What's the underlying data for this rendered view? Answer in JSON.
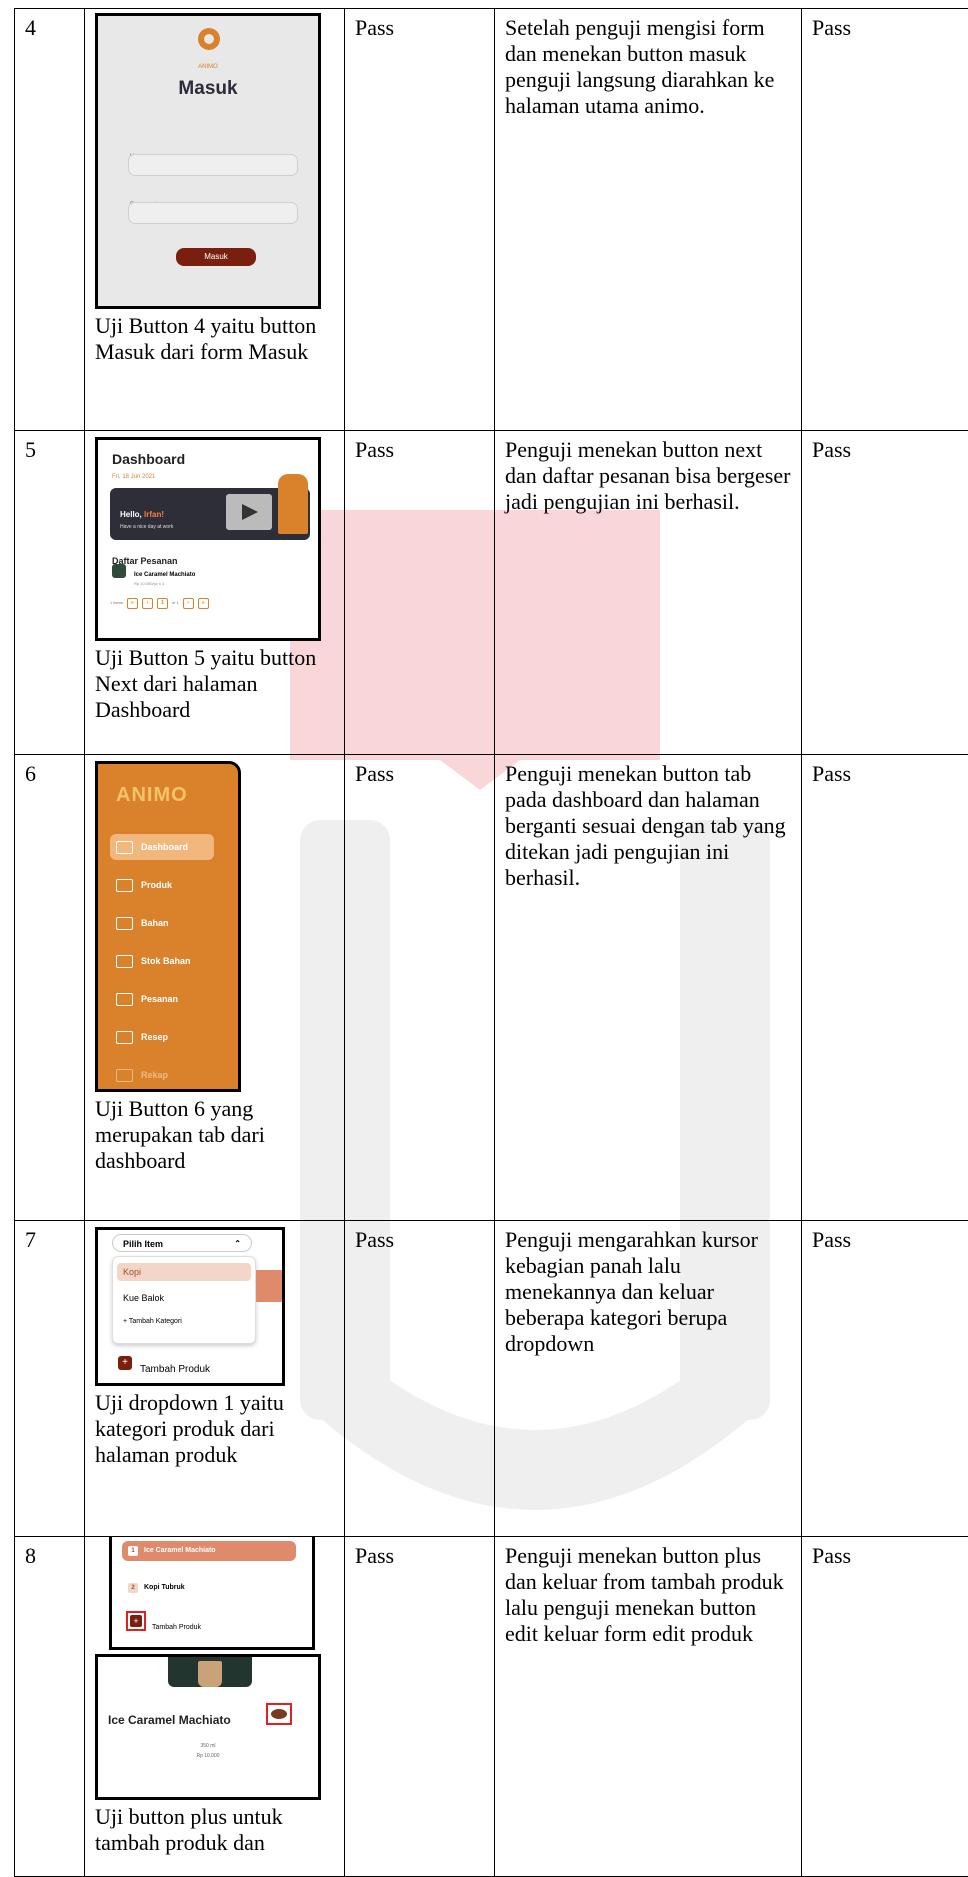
{
  "rows": [
    {
      "no": "4",
      "result": "Pass",
      "description": "Setelah penguji mengisi form dan menekan button masuk penguji langsung diarahkan ke halaman utama animo.",
      "status": "Pass",
      "caption": "Uji Button 4 yaitu button Masuk dari form Masuk",
      "shot": {
        "brand": "ANIMO",
        "title": "Masuk",
        "username_label": "Username",
        "password_label": "Password",
        "button": "Masuk"
      }
    },
    {
      "no": "5",
      "result": "Pass",
      "description": "Penguji menekan button next dan daftar pesanan bisa bergeser jadi pengujian ini berhasil.",
      "status": "Pass",
      "caption": "Uji Button 5 yaitu button Next dari halaman Dashboard",
      "shot": {
        "title": "Dashboard",
        "date": "Fri, 18 Jun 2021",
        "hello": "Hello,",
        "name": "Irfan!",
        "sub": "Have a nice day at work",
        "list_title": "Daftar Pesanan",
        "item": "Ice Caramel Machiato",
        "price": "Rp 10.000/pc x 1",
        "pager": "1 items",
        "pager_of": "of 1"
      }
    },
    {
      "no": "6",
      "result": "Pass",
      "description": "Penguji menekan button tab pada dashboard dan halaman berganti sesuai dengan tab yang ditekan jadi pengujian ini berhasil.",
      "status": "Pass",
      "caption": "Uji Button 6 yang merupakan tab dari dashboard",
      "shot": {
        "brand": "ANIMO",
        "items": [
          "Dashboard",
          "Produk",
          "Bahan",
          "Stok Bahan",
          "Pesanan",
          "Resep",
          "Rekap"
        ]
      }
    },
    {
      "no": "7",
      "result": "Pass",
      "description": "Penguji mengarahkan kursor kebagian panah lalu menekannya dan keluar beberapa kategori berupa dropdown",
      "status": "Pass",
      "caption": "Uji dropdown 1 yaitu kategori produk dari halaman produk",
      "shot": {
        "select": "Pilih Item",
        "options": [
          "Kopi",
          "Kue Balok",
          "+ Tambah Kategori"
        ],
        "add": "Tambah Produk"
      }
    },
    {
      "no": "8",
      "result": "Pass",
      "description": "Penguji menekan button plus dan keluar from tambah produk lalu penguji menekan button edit keluar form edit produk",
      "status": "Pass",
      "caption": "Uji button plus untuk tambah produk dan",
      "shot": {
        "item1": "Ice Caramel Machiato",
        "item2": "Kopi Tubruk",
        "add": "Tambah Produk",
        "product": "Ice Caramel Machiato",
        "size": "350 ml",
        "price": "Rp 10.000"
      }
    }
  ]
}
